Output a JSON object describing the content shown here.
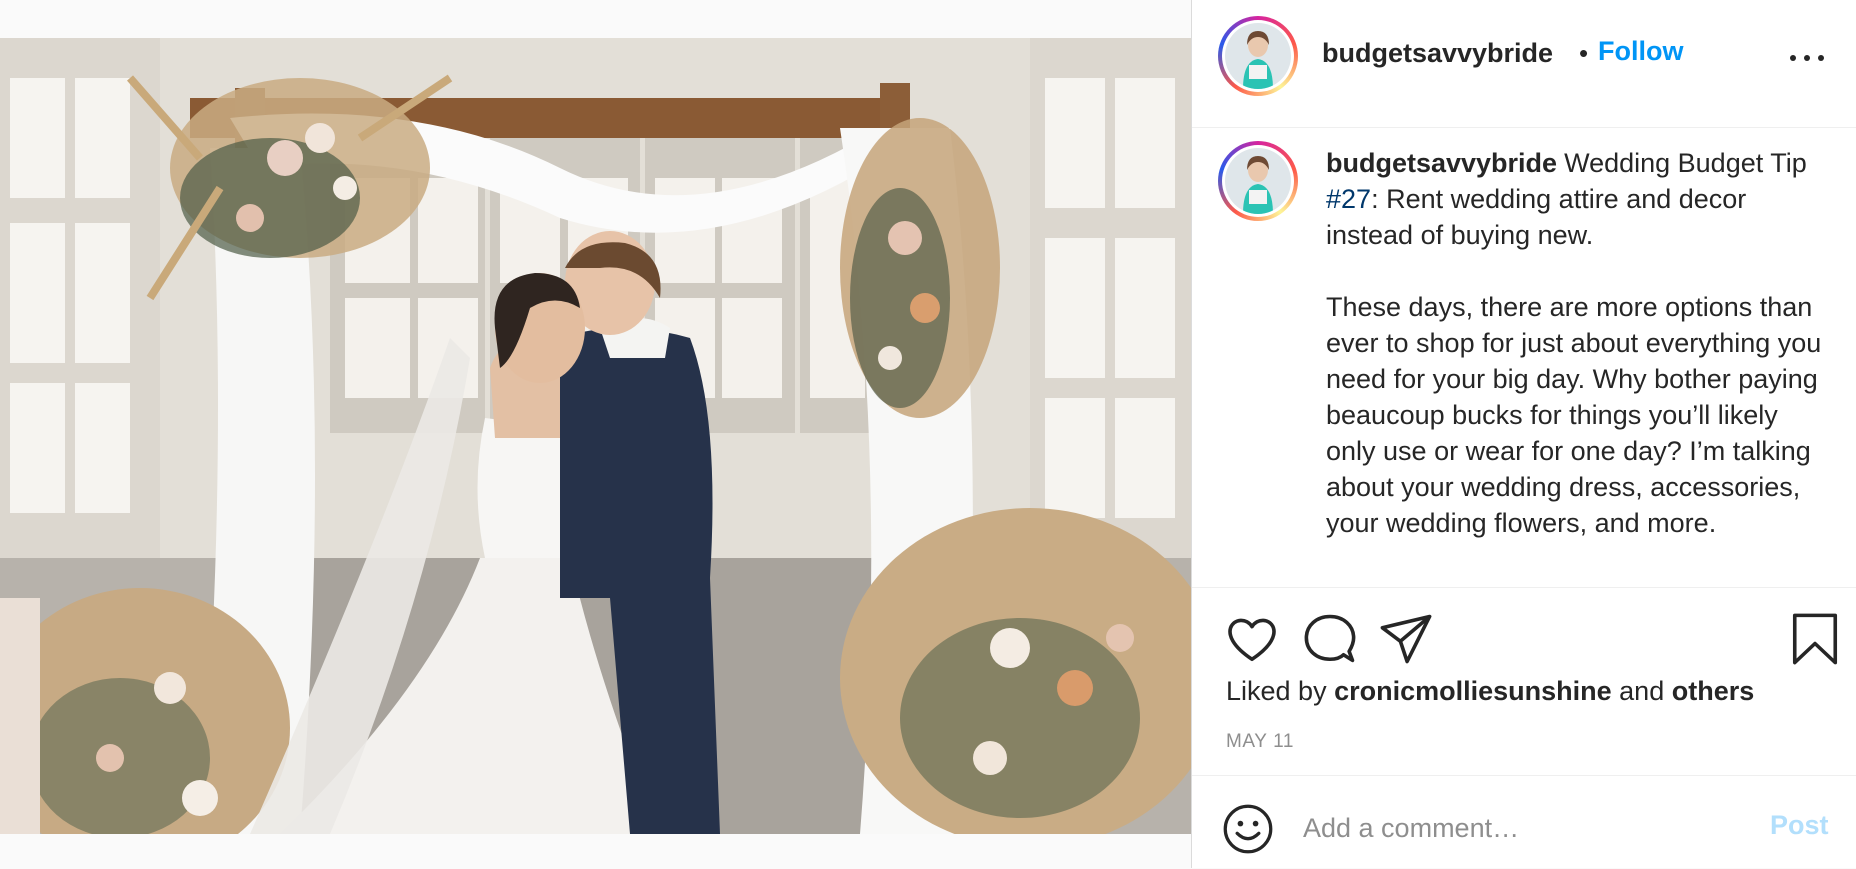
{
  "post": {
    "photo_alt": "Bride and groom kissing under a wedding arch decorated with white drapes, pampas grass and dried flowers"
  },
  "header": {
    "username": "budgetsavvybride",
    "separator": "•",
    "follow_label": "Follow",
    "more_icon": "more-options-icon"
  },
  "caption": {
    "username": "budgetsavvybride",
    "text_before_hashtag": "Wedding Budget Tip ",
    "hashtag": "#27",
    "text_after_hashtag": ": Rent wedding attire and decor instead of buying new.\n\nThese days, there are more options than ever to shop for just about everything you need for your big day. Why bother paying beaucoup bucks for things you’ll likely only use or wear for one day? I’m talking about your wedding dress, accessories, your wedding flowers, and more."
  },
  "actions": {
    "icons": [
      "heart-icon",
      "comment-icon",
      "share-icon",
      "bookmark-icon"
    ],
    "liked_prefix": "Liked by ",
    "liked_user": "cronicmolliesunshine",
    "liked_middle": " and ",
    "liked_others": "others",
    "date": "MAY 11"
  },
  "comment": {
    "placeholder": "Add a comment…",
    "post_label": "Post",
    "emoji_icon": "emoji-icon"
  },
  "colors": {
    "accent": "#0095f6",
    "hashtag": "#00376b",
    "post_disabled": "#b2dffc",
    "secondary_text": "#8e8e8e"
  }
}
